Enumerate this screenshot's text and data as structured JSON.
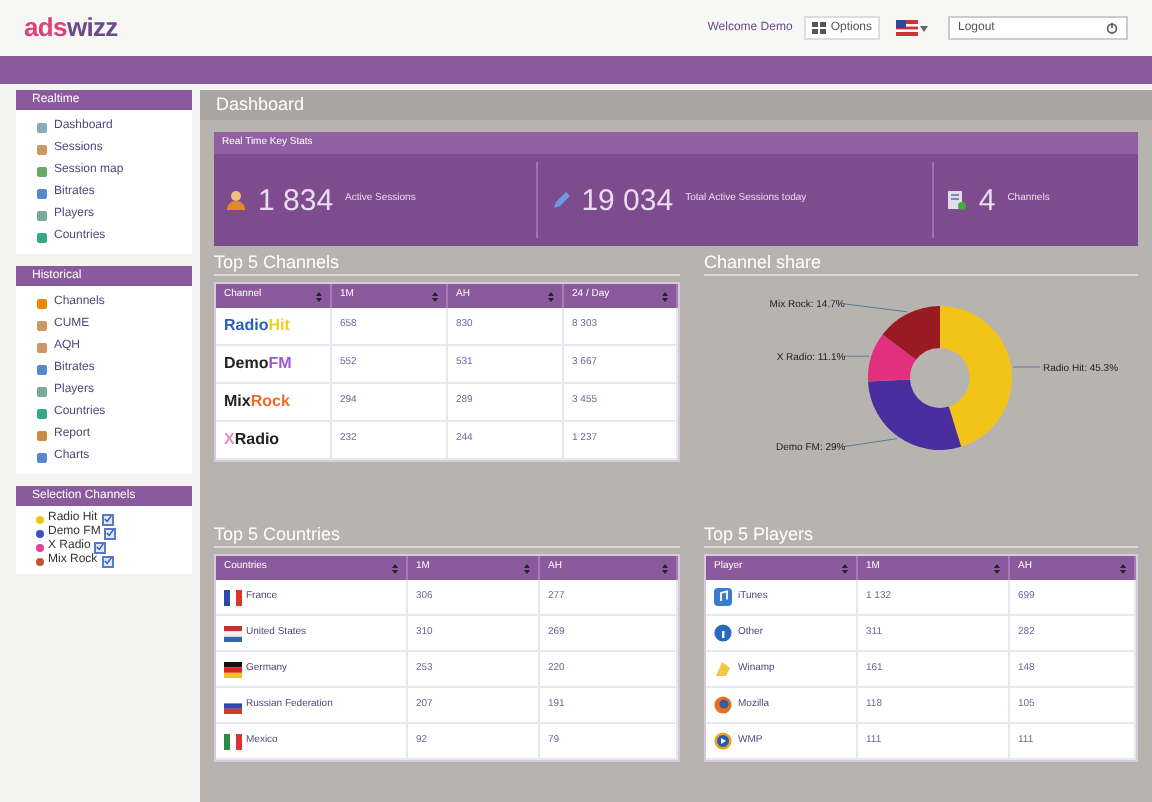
{
  "header": {
    "logo": {
      "accent": "ads",
      "rest": "wizz"
    },
    "welcome": "Welcome Demo",
    "options_button": "Options",
    "logout_field": "Logout"
  },
  "sidebar": [
    {
      "title": "Realtime",
      "items": [
        {
          "label": "Dashboard"
        },
        {
          "label": "Sessions"
        },
        {
          "label": "Session map"
        },
        {
          "label": "Bitrates"
        },
        {
          "label": "Players"
        },
        {
          "label": "Countries"
        }
      ]
    },
    {
      "title": "Historical",
      "items": [
        {
          "label": "Channels"
        },
        {
          "label": "CUME"
        },
        {
          "label": "AQH"
        },
        {
          "label": "Bitrates"
        },
        {
          "label": "Players"
        },
        {
          "label": "Countries"
        },
        {
          "label": "Report"
        },
        {
          "label": "Charts"
        }
      ]
    }
  ],
  "selection_channels": {
    "title": "Selection Channels",
    "items": [
      {
        "label": "Radio Hit",
        "color": "#f2c417",
        "checked": true
      },
      {
        "label": "Demo FM",
        "color": "#3a4fc4",
        "checked": true
      },
      {
        "label": "X Radio",
        "color": "#e0409a",
        "checked": true
      },
      {
        "label": "Mix Rock",
        "color": "#c8502a",
        "checked": true
      }
    ]
  },
  "page_title": "Dashboard",
  "key_stats": {
    "title": "Real Time Key Stats",
    "stats": [
      {
        "value": "1 834",
        "label": "Active Sessions"
      },
      {
        "value": "19 034",
        "label": "Total Active Sessions today"
      },
      {
        "value": "4",
        "label": "Channels"
      }
    ]
  },
  "top_channels": {
    "title": "Top 5 Channels",
    "columns": [
      "Channel",
      "1M",
      "AH",
      "24 / Day"
    ],
    "rows": [
      {
        "cells": [
          {
            "parts": [
              {
                "text": "Radio",
                "color": "#2a5fc0"
              },
              {
                "text": "Hit",
                "color": "#f0d020"
              }
            ]
          },
          "658",
          "830",
          "8 303"
        ]
      },
      {
        "cells": [
          {
            "parts": [
              {
                "text": "Demo",
                "color": "#222222"
              },
              {
                "text": "FM",
                "color": "#9a5ad0"
              }
            ]
          },
          "552",
          "531",
          "3 667"
        ]
      },
      {
        "cells": [
          {
            "parts": [
              {
                "text": "Mix",
                "color": "#222222"
              },
              {
                "text": "Rock",
                "color": "#f06a30"
              }
            ]
          },
          "294",
          "289",
          "3 455"
        ]
      },
      {
        "cells": [
          {
            "parts": [
              {
                "text": "X",
                "color": "#f08ac0"
              },
              {
                "text": "Radio",
                "color": "#222222"
              }
            ]
          },
          "232",
          "244",
          "1 237"
        ]
      }
    ]
  },
  "channel_share": {
    "chart_data": {
      "type": "donut",
      "title": "Channel share",
      "series": [
        {
          "values": [
            45.3,
            29,
            11.1,
            14.7
          ]
        }
      ],
      "value_labels": [
        "Radio Hit: 45.3%",
        "Demo FM: 29%",
        "X Radio: 11.1%",
        "Mix Rock: 14.7%"
      ]
    }
  },
  "top_countries": {
    "title": "Top 5 Countries",
    "columns": [
      "Countries",
      "1M",
      "AH"
    ],
    "rows": [
      {
        "cells": [
          "France",
          "306",
          "277"
        ]
      },
      {
        "cells": [
          "United States",
          "310",
          "269"
        ]
      },
      {
        "cells": [
          "Germany",
          "253",
          "220"
        ]
      },
      {
        "cells": [
          "Russian Federation",
          "207",
          "191"
        ]
      },
      {
        "cells": [
          "Mexico",
          "92",
          "79"
        ]
      }
    ]
  },
  "top_players": {
    "title": "Top 5 Players",
    "columns": [
      "Player",
      "1M",
      "AH"
    ],
    "rows": [
      {
        "cells": [
          "iTunes",
          "1 132",
          "699"
        ]
      },
      {
        "cells": [
          "Other",
          "311",
          "282"
        ]
      },
      {
        "cells": [
          "Winamp",
          "161",
          "148"
        ]
      },
      {
        "cells": [
          "Mozilla",
          "118",
          "105"
        ]
      },
      {
        "cells": [
          "WMP",
          "111",
          "111"
        ]
      }
    ]
  }
}
